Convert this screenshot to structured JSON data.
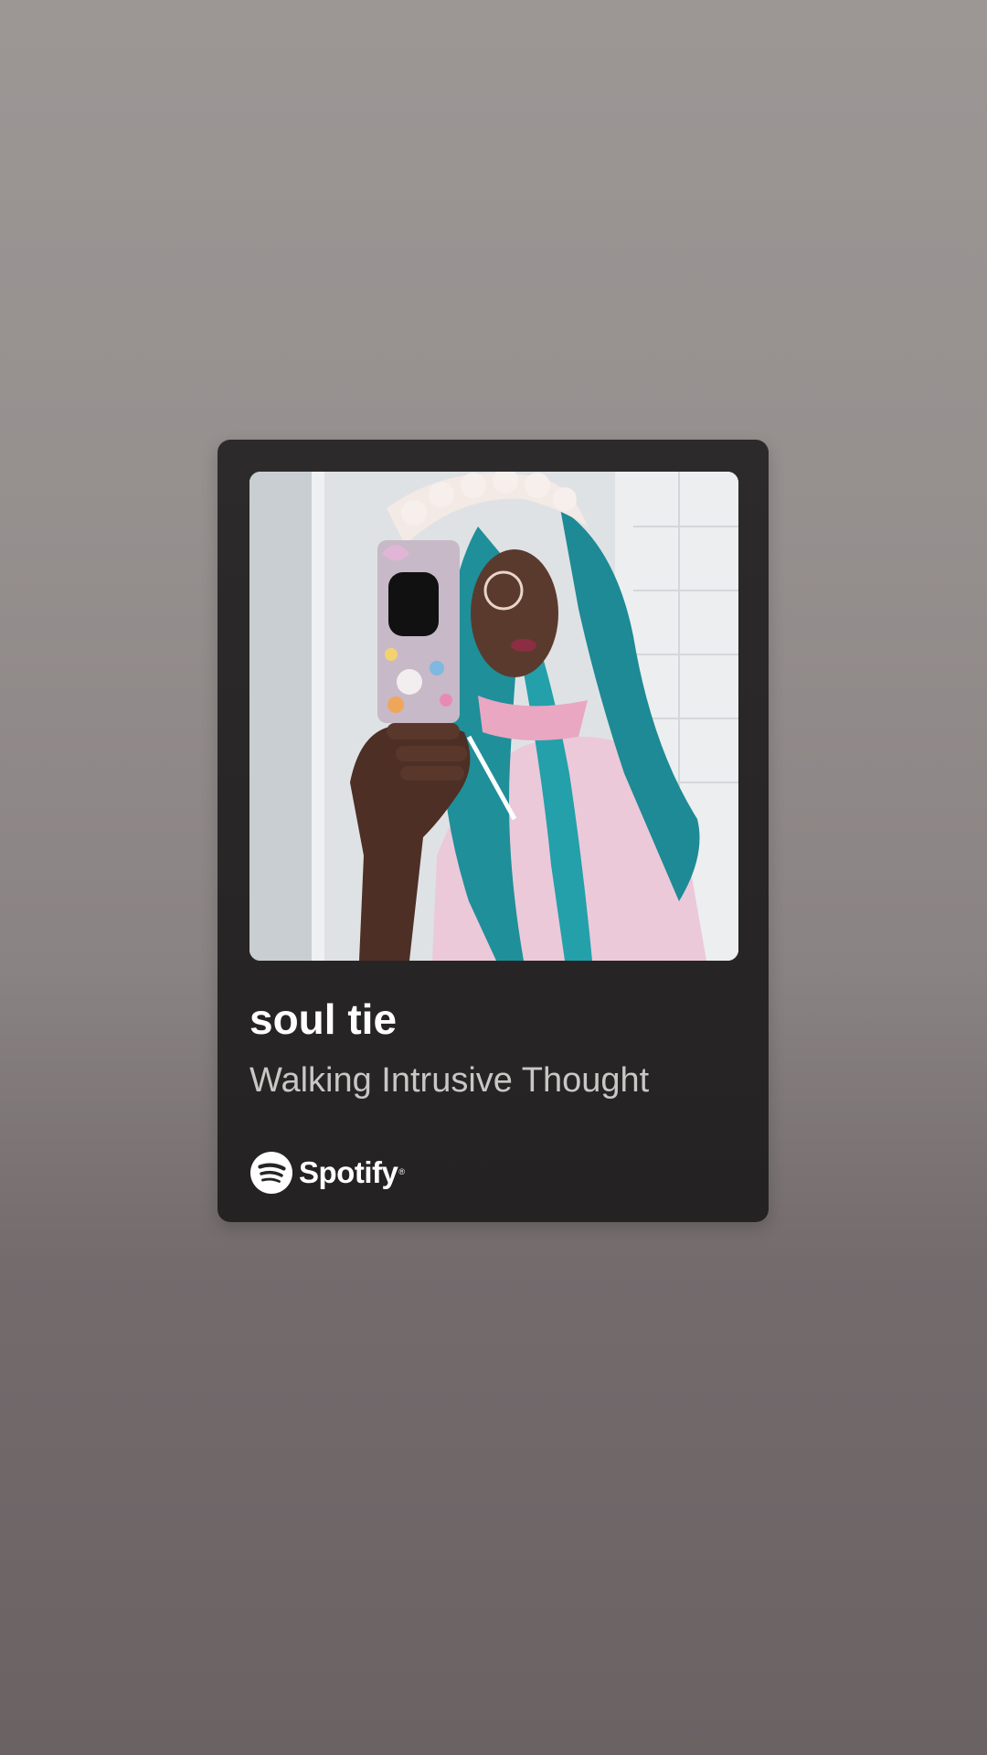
{
  "track": {
    "title": "soul tie",
    "artist": "Walking Intrusive Thought"
  },
  "brand": {
    "name": "Spotify",
    "registered_mark": "®",
    "icon": "spotify-logo-icon"
  },
  "artwork": {
    "description_icon": "album-cover-image"
  },
  "colors": {
    "card_background": "#262424",
    "title": "#ffffff",
    "artist": "#c9c6c6",
    "page_background": "#8f8988"
  }
}
